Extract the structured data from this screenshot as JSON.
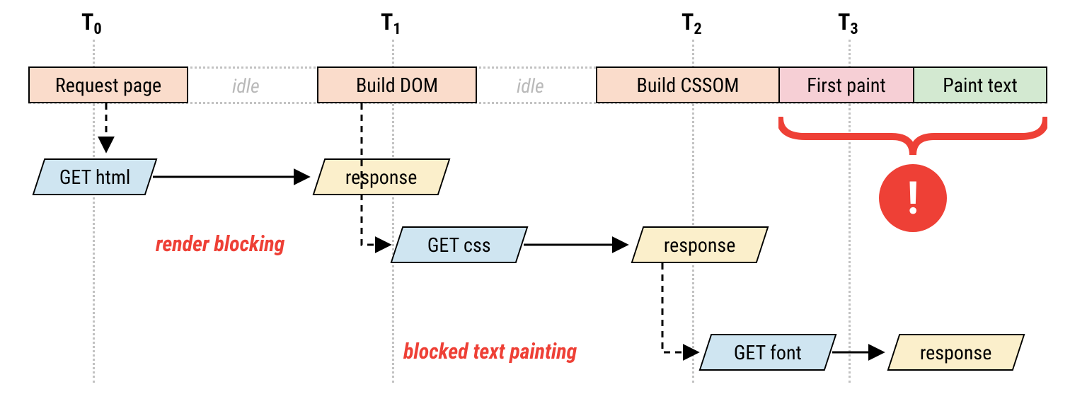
{
  "time_markers": {
    "t0": "T",
    "t0s": "0",
    "t1": "T",
    "t1s": "1",
    "t2": "T",
    "t2s": "2",
    "t3": "T",
    "t3s": "3"
  },
  "row": {
    "request": "Request page",
    "idle1": "idle",
    "build_dom": "Build DOM",
    "idle2": "idle",
    "build_cssom": "Build CSSOM",
    "first_paint": "First paint",
    "paint_text": "Paint text"
  },
  "net": {
    "get_html": "GET html",
    "resp_html": "response",
    "get_css": "GET css",
    "resp_css": "response",
    "get_font": "GET font",
    "resp_font": "response"
  },
  "annotations": {
    "render_blocking": "render blocking",
    "blocked_text_painting": "blocked text painting"
  },
  "badge": "!",
  "colors": {
    "peach": "#fadccb",
    "pink": "#f6cfd5",
    "green": "#d3e9d1",
    "blue": "#cfe5f1",
    "yellow": "#fbefcb",
    "accent": "#ee4036",
    "grid": "#c2c2c2"
  }
}
